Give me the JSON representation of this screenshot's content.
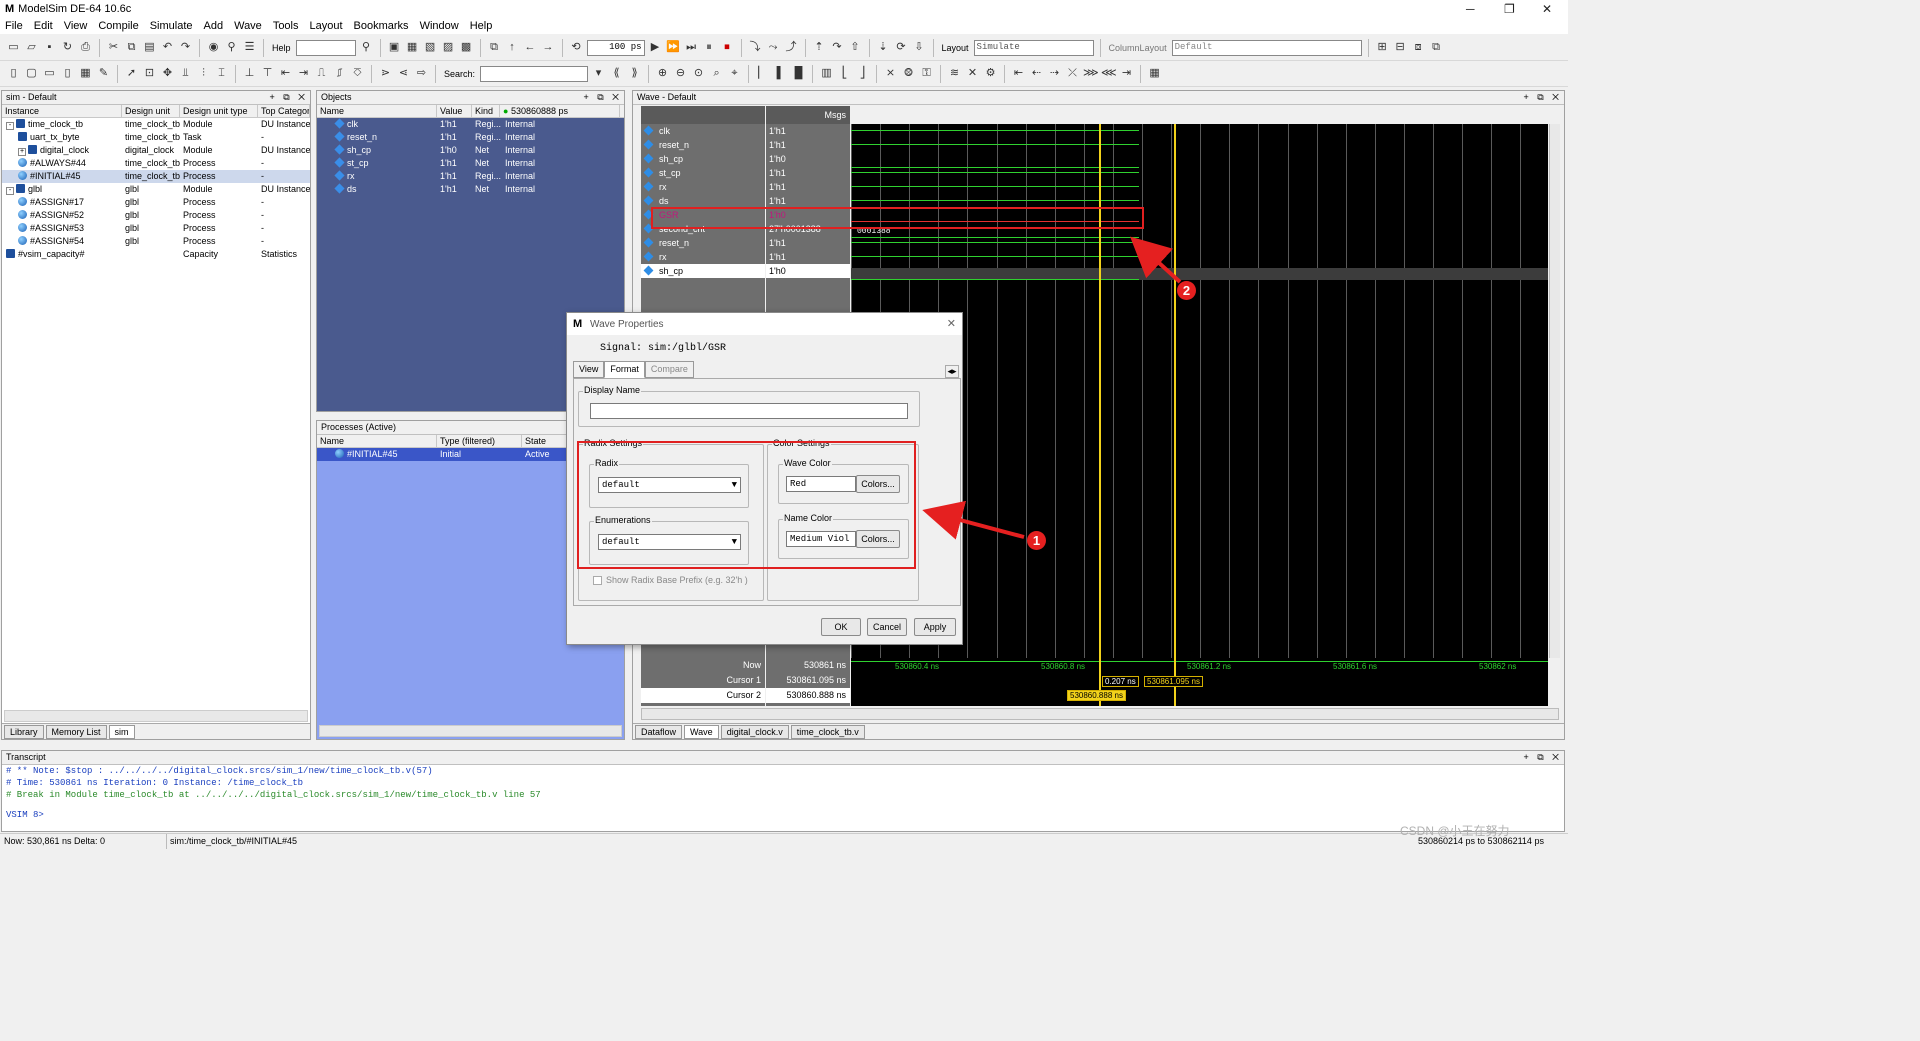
{
  "window": {
    "app_logo": "M",
    "title": "ModelSim DE-64 10.6c"
  },
  "menu": [
    "File",
    "Edit",
    "View",
    "Compile",
    "Simulate",
    "Add",
    "Wave",
    "Tools",
    "Layout",
    "Bookmarks",
    "Window",
    "Help"
  ],
  "toolbar": {
    "help_label": "Help",
    "time_step_value": "100 ps",
    "layout_label": "Layout",
    "layout_value": "Simulate",
    "column_layout_label": "ColumnLayout",
    "column_layout_value": "Default",
    "search_label": "Search:"
  },
  "sim_panel": {
    "title": "sim - Default",
    "columns": [
      "Instance",
      "Design unit",
      "Design unit type",
      "Top Category"
    ],
    "rows": [
      {
        "instance": "time_clock_tb",
        "unit": "time_clock_tb",
        "type": "Module",
        "cat": "DU Instance",
        "level": 0,
        "expander": "-",
        "icon": "mod"
      },
      {
        "instance": "uart_tx_byte",
        "unit": "time_clock_tb",
        "type": "Task",
        "cat": "-",
        "level": 1,
        "expander": "",
        "icon": "mod"
      },
      {
        "instance": "digital_clock",
        "unit": "digital_clock",
        "type": "Module",
        "cat": "DU Instance",
        "level": 1,
        "expander": "+",
        "icon": "mod"
      },
      {
        "instance": "#ALWAYS#44",
        "unit": "time_clock_tb",
        "type": "Process",
        "cat": "-",
        "level": 1,
        "expander": "",
        "icon": "proc"
      },
      {
        "instance": "#INITIAL#45",
        "unit": "time_clock_tb",
        "type": "Process",
        "cat": "-",
        "level": 1,
        "expander": "",
        "icon": "proc",
        "selected": true
      },
      {
        "instance": "glbl",
        "unit": "glbl",
        "type": "Module",
        "cat": "DU Instance",
        "level": 0,
        "expander": "-",
        "icon": "mod"
      },
      {
        "instance": "#ASSIGN#17",
        "unit": "glbl",
        "type": "Process",
        "cat": "-",
        "level": 1,
        "expander": "",
        "icon": "proc"
      },
      {
        "instance": "#ASSIGN#52",
        "unit": "glbl",
        "type": "Process",
        "cat": "-",
        "level": 1,
        "expander": "",
        "icon": "proc"
      },
      {
        "instance": "#ASSIGN#53",
        "unit": "glbl",
        "type": "Process",
        "cat": "-",
        "level": 1,
        "expander": "",
        "icon": "proc"
      },
      {
        "instance": "#ASSIGN#54",
        "unit": "glbl",
        "type": "Process",
        "cat": "-",
        "level": 1,
        "expander": "",
        "icon": "proc"
      },
      {
        "instance": "#vsim_capacity#",
        "unit": "",
        "type": "Capacity",
        "cat": "Statistics",
        "level": 0,
        "expander": "",
        "icon": "mod"
      }
    ]
  },
  "left_tabs": [
    "Library",
    "Memory List",
    "sim"
  ],
  "objects_panel": {
    "title": "Objects",
    "columns": [
      "Name",
      "Value",
      "Kind"
    ],
    "now_value": "530860888",
    "now_unit": "ps",
    "rows": [
      {
        "name": "clk",
        "value": "1'h1",
        "kind": "Regi...",
        "mode": "Internal"
      },
      {
        "name": "reset_n",
        "value": "1'h1",
        "kind": "Regi...",
        "mode": "Internal"
      },
      {
        "name": "sh_cp",
        "value": "1'h0",
        "kind": "Net",
        "mode": "Internal"
      },
      {
        "name": "st_cp",
        "value": "1'h1",
        "kind": "Net",
        "mode": "Internal"
      },
      {
        "name": "rx",
        "value": "1'h1",
        "kind": "Regi...",
        "mode": "Internal"
      },
      {
        "name": "ds",
        "value": "1'h1",
        "kind": "Net",
        "mode": "Internal"
      }
    ]
  },
  "processes_panel": {
    "title": "Processes (Active)",
    "columns": [
      "Name",
      "Type (filtered)",
      "State"
    ],
    "rows": [
      {
        "name": "#INITIAL#45",
        "type": "Initial",
        "state": "Active"
      }
    ]
  },
  "wave_panel": {
    "title": "Wave - Default",
    "msgs_header": "Msgs",
    "signals": [
      {
        "name": "clk",
        "value": "1'h1"
      },
      {
        "name": "reset_n",
        "value": "1'h1"
      },
      {
        "name": "sh_cp",
        "value": "1'h0"
      },
      {
        "name": "st_cp",
        "value": "1'h1"
      },
      {
        "name": "rx",
        "value": "1'h1"
      },
      {
        "name": "ds",
        "value": "1'h1"
      },
      {
        "name": "GSR",
        "value": "1'h0"
      },
      {
        "name": "second_cnt",
        "value": "27'h0001388"
      },
      {
        "name": "reset_n",
        "value": "1'h1"
      },
      {
        "name": "rx",
        "value": "1'h1"
      },
      {
        "name": "sh_cp",
        "value": "1'h0"
      }
    ],
    "bus_value": "0001388",
    "cursors": [
      {
        "label": "Now",
        "value": "530861 ns"
      },
      {
        "label": "Cursor 1",
        "value": "530861.095 ns"
      },
      {
        "label": "Cursor 2",
        "value": "530860.888 ns"
      }
    ],
    "ticks": [
      "530860.4 ns",
      "530860.8 ns",
      "530861.2 ns",
      "530861.6 ns",
      "530862 ns"
    ],
    "delta_label": "0.207 ns",
    "cursor1_label": "530861.095 ns",
    "cursor2_label": "530860.888 ns"
  },
  "right_tabs": [
    "Dataflow",
    "Wave",
    "digital_clock.v",
    "time_clock_tb.v"
  ],
  "dialog": {
    "title": "Wave Properties",
    "signal": "Signal: sim:/glbl/GSR",
    "tabs": [
      "View",
      "Format",
      "Compare"
    ],
    "display_name_label": "Display Name",
    "display_name_value": "",
    "radix_settings_label": "Radix Settings",
    "radix_label": "Radix",
    "radix_value": "default",
    "enumerations_label": "Enumerations",
    "enumerations_value": "default",
    "color_settings_label": "Color Settings",
    "wave_color_label": "Wave Color",
    "wave_color_value": "Red",
    "name_color_label": "Name Color",
    "name_color_value": "Medium Viol",
    "colors_button": "Colors...",
    "radix_prefix_label": "Show Radix Base Prefix (e.g. 32'h )",
    "ok": "OK",
    "cancel": "Cancel",
    "apply": "Apply"
  },
  "callouts": [
    "1",
    "2"
  ],
  "transcript": {
    "title": "Transcript",
    "lines": [
      "# ** Note: $stop    : ../../../../digital_clock.srcs/sim_1/new/time_clock_tb.v(57)",
      "#    Time: 530861 ns  Iteration: 0  Instance: /time_clock_tb",
      "# Break in Module time_clock_tb at ../../../../digital_clock.srcs/sim_1/new/time_clock_tb.v line 57"
    ],
    "prompt": "VSIM 8>"
  },
  "statusbar": {
    "now": "Now: 530,861 ns  Delta: 0",
    "context": "sim:/time_clock_tb/#INITIAL#45",
    "range": "530860214 ps to 530862114 ps",
    "watermark": "CSDN @小王在努力"
  },
  "colors": {
    "highlight_red": "#e02020",
    "wave_green": "#2fd12f",
    "cursor_yellow": "#f2d21b",
    "gsr_magenta": "#c0187c",
    "objects_bg": "#4a5a8e",
    "processes_bg": "#8aa0f0"
  }
}
